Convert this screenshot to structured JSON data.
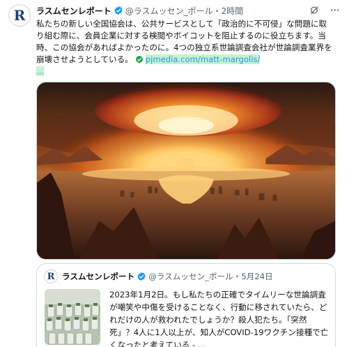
{
  "tweet": {
    "author_name": "ラスムセンレポート",
    "handle_time": "@ラスムッセン_ポール・2時間",
    "avatar_letter": "R",
    "text": "私たちの新しい全国協会は、公共サービスとして「政治的に不可侵」な問題に取り組む際に、会員企業に対する検閲やボイコットを阻止するのに役立ちます。当時、この協会があればよかったのに。4つの独立系世論調査会社が世論調査業界を崩壊させようとしている。",
    "link_text": "pjmedia.com/matt-margolis/",
    "link_ellipsis": "...",
    "icons": {
      "verified": "verified-badge-icon",
      "grok": "grok-icon",
      "more": "more-options-icon",
      "link_check": "check-circle-icon"
    },
    "media": {
      "icon": "nuclear-explosion-image"
    }
  },
  "quoted_tweet": {
    "author_name": "ラスムセンレポート",
    "handle_date": "@ラスムッセン_ポール・5月24日",
    "avatar_letter": "R",
    "text": "2023年1月2日。もし私たちの正確でタイムリーな世論調査が嘲笑や中傷を受けることなく、行動に移されていたら、どれだけの人が救われたでしょうか？殺人犯たち。「突然死」？4人に1人以上が、知人がCOVID-19ワクチン接種で亡くなったと考えている - ...",
    "thumbnail": "vaccine-vials-image"
  },
  "colors": {
    "accent": "#1d9bf0",
    "secondary_text": "#536471",
    "link_highlight": "#c6f2cd",
    "border": "#cfd9de"
  }
}
